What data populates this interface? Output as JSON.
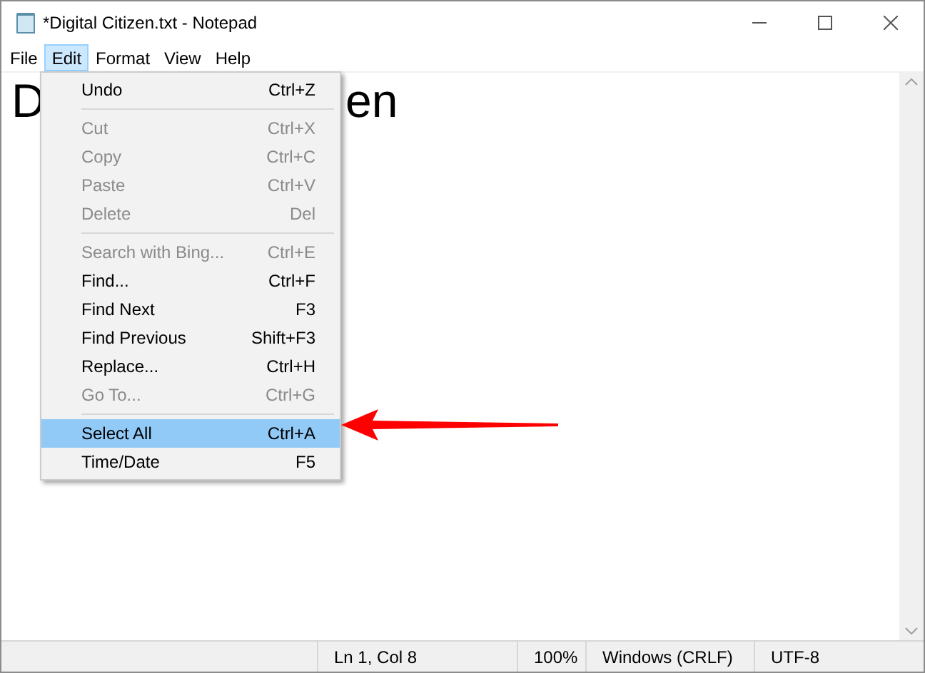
{
  "window": {
    "title": "*Digital Citizen.txt - Notepad"
  },
  "menu_bar": [
    {
      "label": "File",
      "selected": false
    },
    {
      "label": "Edit",
      "selected": true
    },
    {
      "label": "Format",
      "selected": false
    },
    {
      "label": "View",
      "selected": false
    },
    {
      "label": "Help",
      "selected": false
    }
  ],
  "document": {
    "visible_text": [
      "D",
      "en"
    ]
  },
  "edit_menu": [
    {
      "kind": "item",
      "label": "Undo",
      "shortcut": "Ctrl+Z",
      "disabled": false,
      "selected": false
    },
    {
      "kind": "separator"
    },
    {
      "kind": "item",
      "label": "Cut",
      "shortcut": "Ctrl+X",
      "disabled": true,
      "selected": false
    },
    {
      "kind": "item",
      "label": "Copy",
      "shortcut": "Ctrl+C",
      "disabled": true,
      "selected": false
    },
    {
      "kind": "item",
      "label": "Paste",
      "shortcut": "Ctrl+V",
      "disabled": true,
      "selected": false
    },
    {
      "kind": "item",
      "label": "Delete",
      "shortcut": "Del",
      "disabled": true,
      "selected": false
    },
    {
      "kind": "separator"
    },
    {
      "kind": "item",
      "label": "Search with Bing...",
      "shortcut": "Ctrl+E",
      "disabled": true,
      "selected": false
    },
    {
      "kind": "item",
      "label": "Find...",
      "shortcut": "Ctrl+F",
      "disabled": false,
      "selected": false
    },
    {
      "kind": "item",
      "label": "Find Next",
      "shortcut": "F3",
      "disabled": false,
      "selected": false
    },
    {
      "kind": "item",
      "label": "Find Previous",
      "shortcut": "Shift+F3",
      "disabled": false,
      "selected": false
    },
    {
      "kind": "item",
      "label": "Replace...",
      "shortcut": "Ctrl+H",
      "disabled": false,
      "selected": false
    },
    {
      "kind": "item",
      "label": "Go To...",
      "shortcut": "Ctrl+G",
      "disabled": true,
      "selected": false
    },
    {
      "kind": "separator"
    },
    {
      "kind": "item",
      "label": "Select All",
      "shortcut": "Ctrl+A",
      "disabled": false,
      "selected": true
    },
    {
      "kind": "item",
      "label": "Time/Date",
      "shortcut": "F5",
      "disabled": false,
      "selected": false
    }
  ],
  "status_bar": [
    "Ln 1, Col 8",
    "100%",
    "Windows (CRLF)",
    "UTF-8"
  ]
}
